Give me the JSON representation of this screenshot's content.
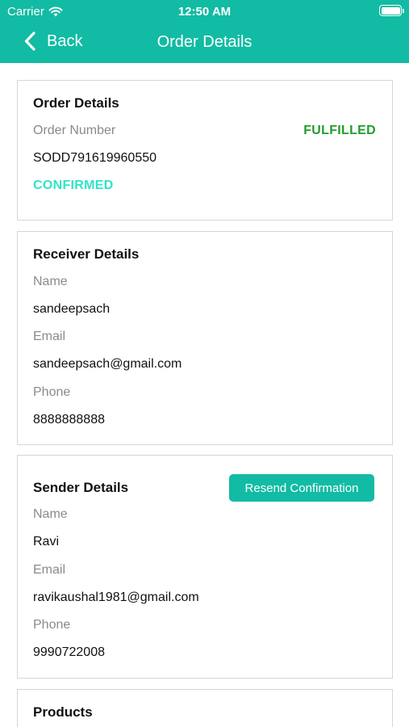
{
  "status_bar": {
    "carrier": "Carrier",
    "time": "12:50 AM"
  },
  "nav": {
    "back_label": "Back",
    "title": "Order Details"
  },
  "order": {
    "title": "Order Details",
    "number_label": "Order Number",
    "number": "SODD791619960550",
    "fulfillment_status": "FULFILLED",
    "confirmation_status": "CONFIRMED"
  },
  "receiver": {
    "title": "Receiver Details",
    "name_label": "Name",
    "name": "sandeepsach",
    "email_label": "Email",
    "email": "sandeepsach@gmail.com",
    "phone_label": "Phone",
    "phone": "8888888888"
  },
  "sender": {
    "title": "Sender Details",
    "resend_label": "Resend Confirmation",
    "name_label": "Name",
    "name": "Ravi",
    "email_label": "Email",
    "email": "ravikaushal1981@gmail.com",
    "phone_label": "Phone",
    "phone": "9990722008"
  },
  "products": {
    "title": "Products"
  },
  "colors": {
    "accent": "#12bba3",
    "fulfilled": "#1f9d2b",
    "confirmed": "#2ee5c6",
    "label_gray": "#8a8a8a"
  },
  "icons": {
    "back": "chevron-left-icon",
    "wifi": "wifi-icon",
    "battery": "battery-icon"
  }
}
